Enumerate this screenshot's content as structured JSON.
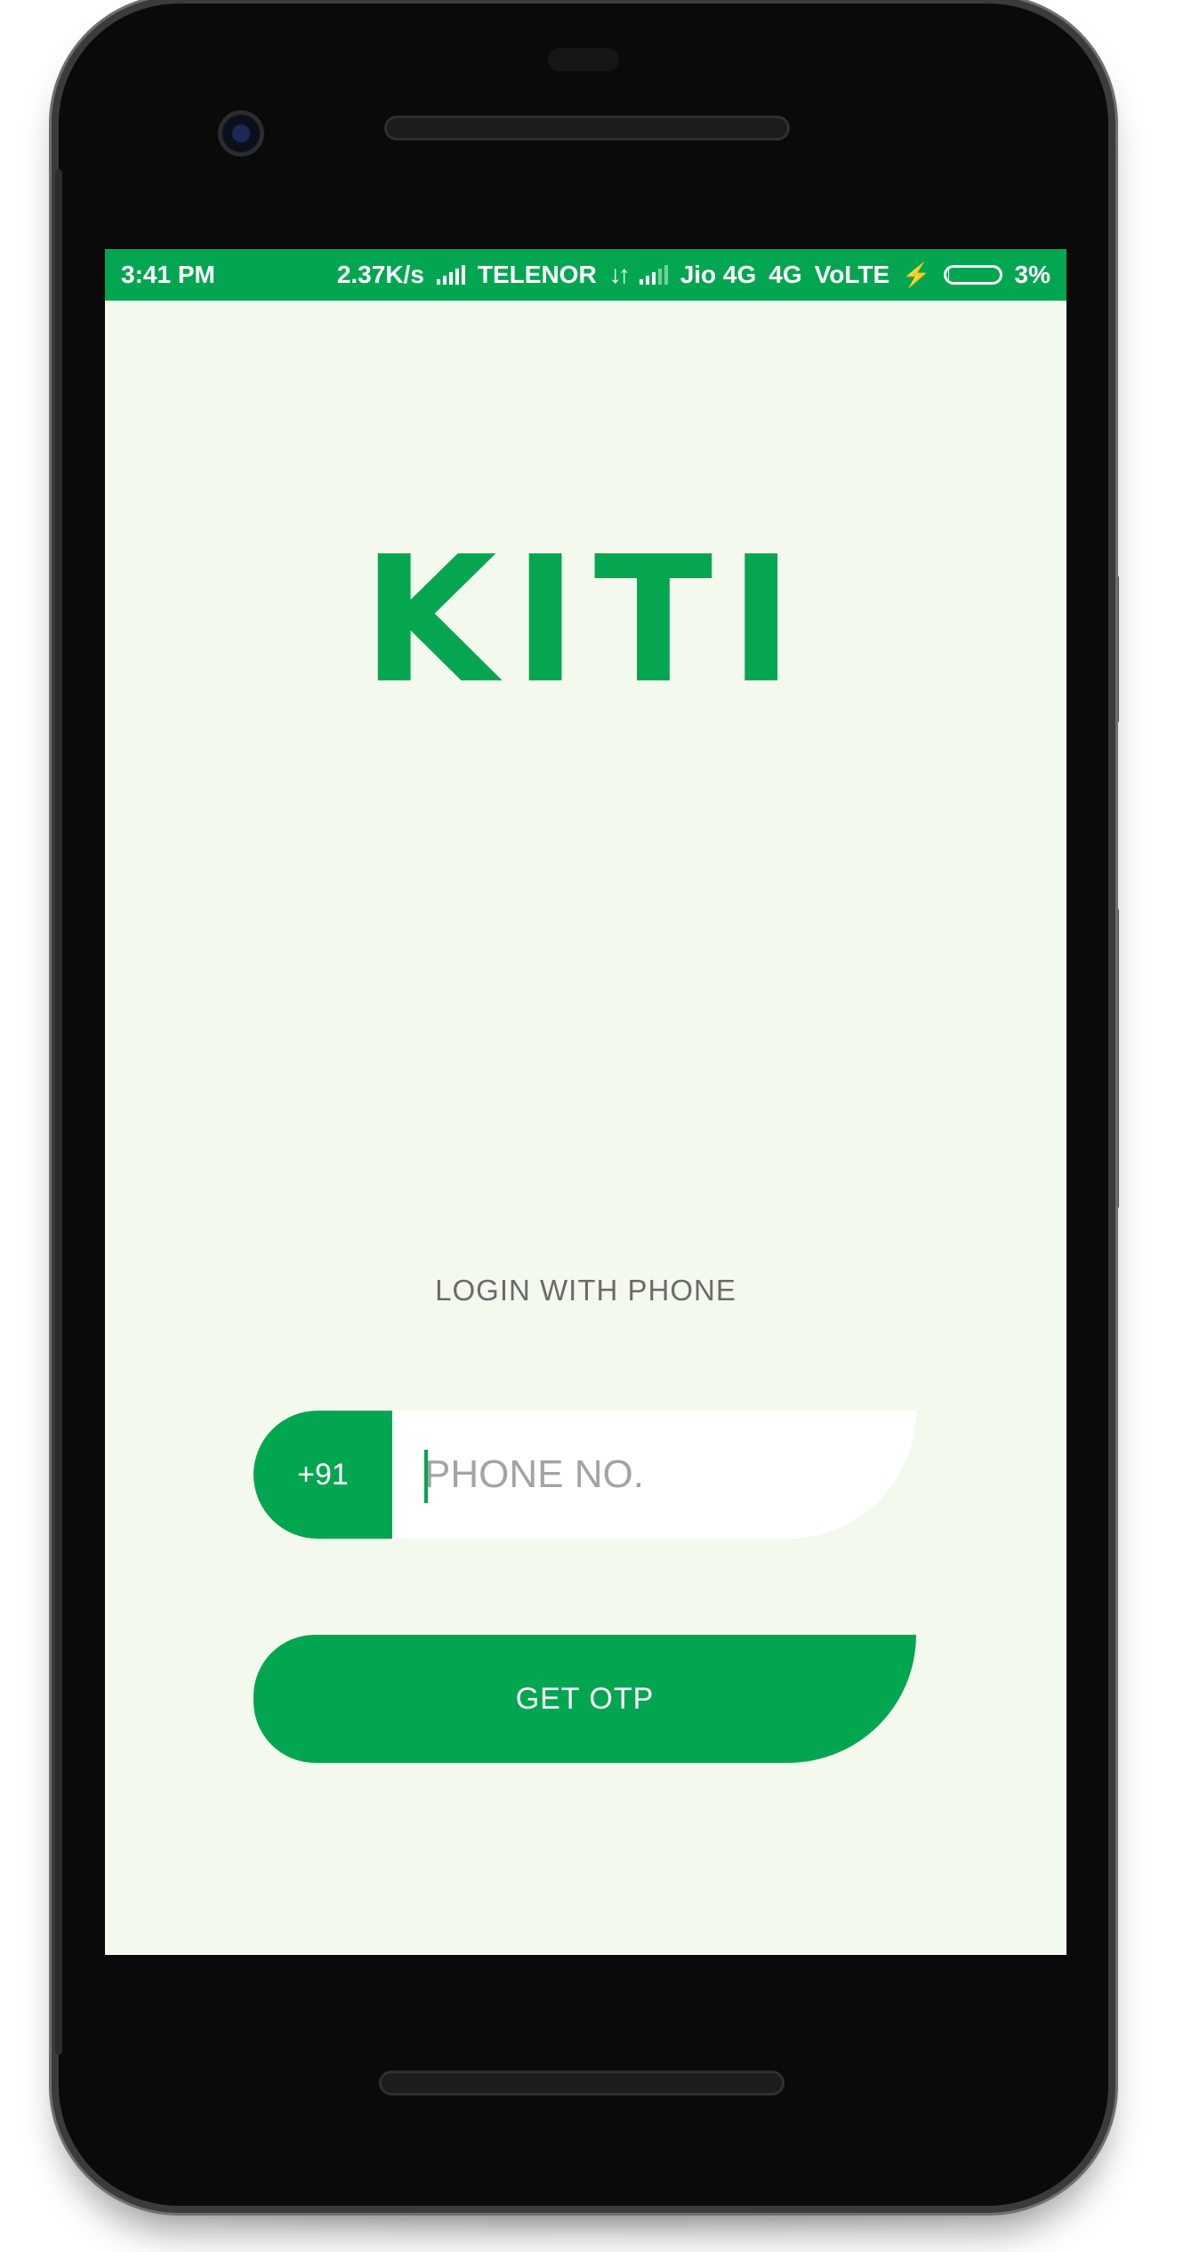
{
  "status_bar": {
    "time": "3:41 PM",
    "speed": "2.37K/s",
    "carrier1": "TELENOR",
    "carrier2": "Jio 4G",
    "network": "4G",
    "volte": "VoLTE",
    "battery": "3%",
    "battery_level": 0.03,
    "icons": [
      "signal-icon",
      "data-arrows-icon",
      "signal-icon",
      "charging-bolt-icon",
      "battery-icon"
    ]
  },
  "logo": {
    "text": "KITI"
  },
  "login": {
    "title": "LOGIN WITH PHONE",
    "country_code": "+91",
    "phone_placeholder": "PHONE NO.",
    "phone_value": "",
    "button_label": "GET OTP"
  },
  "colors": {
    "brand_green": "#02a651",
    "screen_background": "#f4f9ee",
    "label_gray": "#6b6b6b",
    "placeholder_gray": "#a3a3a3"
  }
}
